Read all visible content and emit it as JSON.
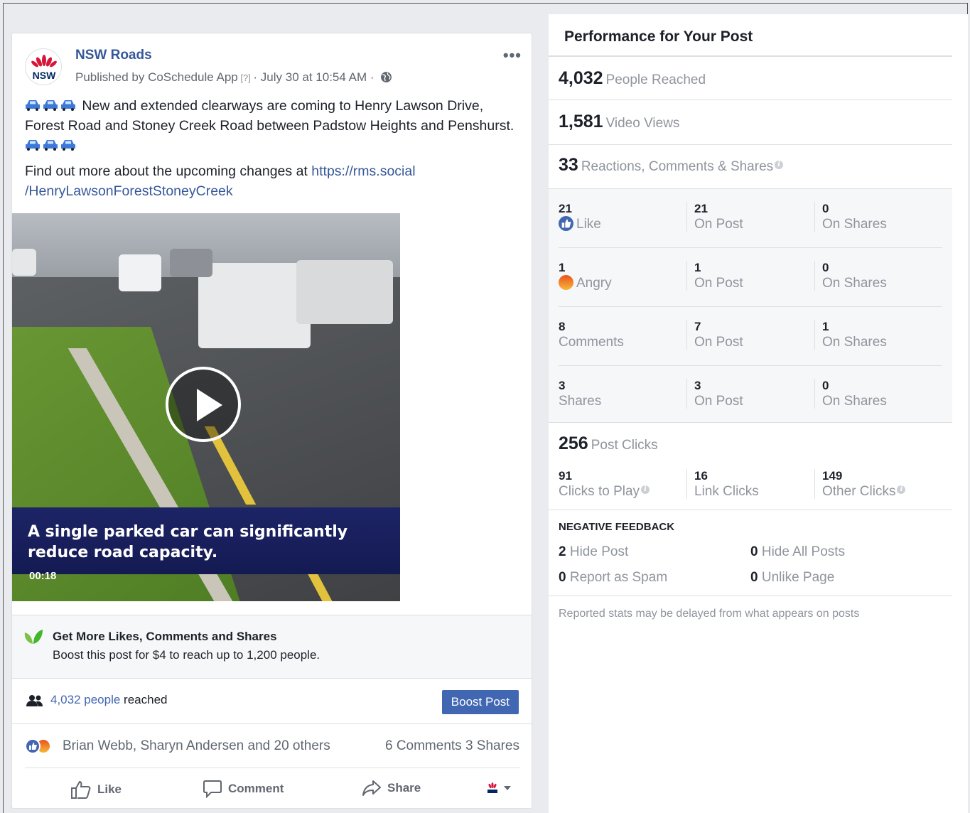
{
  "post": {
    "page_name": "NSW Roads",
    "avatar_text": "NSW",
    "byline_prefix": "Published by ",
    "byline_app": "CoSchedule App",
    "byline_q": " [?] ",
    "byline_date": "· July 30 at 10:54 AM ·",
    "more": "•••",
    "text_line1": "New and extended clearways are coming to Henry Lawson Drive, Forest Road and Stoney Creek Road between Padstow Heights and Penshurst.",
    "text_line2_prefix": "Find out more about the upcoming changes at ",
    "link": "https://rms.social /HenryLawsonForestStoneyCreek",
    "video": {
      "caption": "A single parked car can significantly reduce road capacity.",
      "duration": "00:18"
    },
    "boost": {
      "title": "Get More Likes, Comments and Shares",
      "subtitle": "Boost this post for $4 to reach up to 1,200 people."
    },
    "reach": {
      "count_link": "4,032 people",
      "suffix": " reached",
      "button": "Boost Post"
    },
    "social": {
      "names": "Brian Webb, Sharyn Andersen and 20 others",
      "counts": "6 Comments  3 Shares"
    },
    "actions": {
      "like": "Like",
      "comment": "Comment",
      "share": "Share"
    }
  },
  "panel": {
    "title": "Performance for Your Post",
    "people_reached": {
      "value": "4,032",
      "label": "People Reached"
    },
    "video_views": {
      "value": "1,581",
      "label": "Video Views"
    },
    "engagement": {
      "value": "33",
      "label": "Reactions, Comments & Shares"
    },
    "rows": [
      {
        "c1_num": "21",
        "c1_lbl": "Like",
        "c2_num": "21",
        "c2_lbl": "On Post",
        "c3_num": "0",
        "c3_lbl": "On Shares"
      },
      {
        "c1_num": "1",
        "c1_lbl": "Angry",
        "c2_num": "1",
        "c2_lbl": "On Post",
        "c3_num": "0",
        "c3_lbl": "On Shares"
      },
      {
        "c1_num": "8",
        "c1_lbl": "Comments",
        "c2_num": "7",
        "c2_lbl": "On Post",
        "c3_num": "1",
        "c3_lbl": "On Shares"
      },
      {
        "c1_num": "3",
        "c1_lbl": "Shares",
        "c2_num": "3",
        "c2_lbl": "On Post",
        "c3_num": "0",
        "c3_lbl": "On Shares"
      }
    ],
    "post_clicks": {
      "value": "256",
      "label": "Post Clicks"
    },
    "clicks": [
      {
        "num": "91",
        "lbl": "Clicks to Play"
      },
      {
        "num": "16",
        "lbl": "Link Clicks"
      },
      {
        "num": "149",
        "lbl": "Other Clicks"
      }
    ],
    "negative": {
      "title": "NEGATIVE FEEDBACK",
      "hide_post": {
        "value": "2",
        "label": "Hide Post"
      },
      "hide_all": {
        "value": "0",
        "label": "Hide All Posts"
      },
      "spam": {
        "value": "0",
        "label": "Report as Spam"
      },
      "unlike": {
        "value": "0",
        "label": "Unlike Page"
      }
    },
    "footnote": "Reported stats may be delayed from what appears on posts"
  }
}
